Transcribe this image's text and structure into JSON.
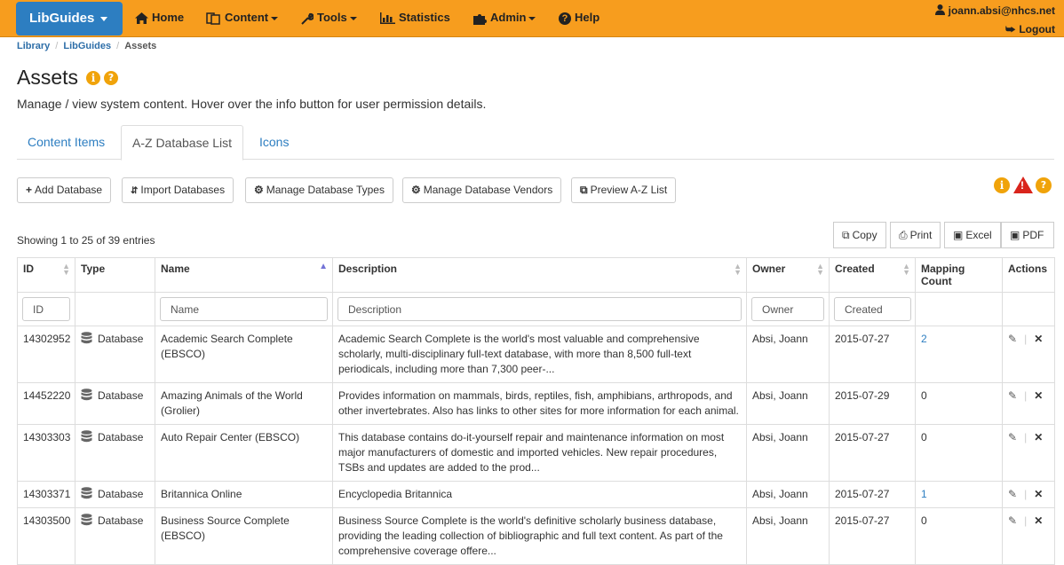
{
  "nav": {
    "brand": "LibGuides",
    "items": [
      {
        "label": "Home",
        "icon": "home-icon"
      },
      {
        "label": "Content",
        "icon": "content-icon"
      },
      {
        "label": "Tools",
        "icon": "wrench-icon"
      },
      {
        "label": "Statistics",
        "icon": "bar-chart-icon"
      },
      {
        "label": "Admin",
        "icon": "puzzle-icon"
      },
      {
        "label": "Help",
        "icon": "help-icon"
      }
    ],
    "user_email": "joann.absi@nhcs.net",
    "logout": "Logout"
  },
  "breadcrumb": [
    "Library",
    "LibGuides",
    "Assets"
  ],
  "page": {
    "title": "Assets",
    "subtitle": "Manage / view system content. Hover over the info button for user permission details."
  },
  "tabs": [
    "Content Items",
    "A-Z Database List",
    "Icons"
  ],
  "toolbar": {
    "add": "Add Database",
    "import": "Import Databases",
    "types": "Manage Database Types",
    "vendors": "Manage Database Vendors",
    "preview": "Preview A-Z List"
  },
  "showing": "Showing 1 to 25 of 39 entries",
  "export": {
    "copy": "Copy",
    "print": "Print",
    "excel": "Excel",
    "pdf": "PDF"
  },
  "columns": [
    "ID",
    "Type",
    "Name",
    "Description",
    "Owner",
    "Created",
    "Mapping Count",
    "Actions"
  ],
  "filters": {
    "id": "ID",
    "name": "Name",
    "description": "Description",
    "owner": "Owner",
    "created": "Created"
  },
  "rows": [
    {
      "id": "14302952",
      "type": "Database",
      "name": "Academic Search Complete (EBSCO)",
      "description": "Academic Search Complete is the world's most valuable and comprehensive scholarly, multi-disciplinary full-text database, with more than 8,500 full-text periodicals, including more than 7,300 peer-...",
      "owner": "Absi, Joann",
      "created": "2015-07-27",
      "mapping": "2",
      "mapping_link": true
    },
    {
      "id": "14452220",
      "type": "Database",
      "name": "Amazing Animals of the World (Grolier)",
      "description": "Provides information on mammals, birds, reptiles, fish, amphibians, arthropods, and other invertebrates. Also has links to other sites for more information for each animal.",
      "owner": "Absi, Joann",
      "created": "2015-07-29",
      "mapping": "0",
      "mapping_link": false
    },
    {
      "id": "14303303",
      "type": "Database",
      "name": "Auto Repair Center (EBSCO)",
      "description": "This database contains do-it-yourself repair and maintenance information on most major manufacturers of domestic and imported vehicles. New repair procedures, TSBs and updates are added to the prod...",
      "owner": "Absi, Joann",
      "created": "2015-07-27",
      "mapping": "0",
      "mapping_link": false
    },
    {
      "id": "14303371",
      "type": "Database",
      "name": "Britannica Online",
      "description": "Encyclopedia Britannica",
      "owner": "Absi, Joann",
      "created": "2015-07-27",
      "mapping": "1",
      "mapping_link": true
    },
    {
      "id": "14303500",
      "type": "Database",
      "name": "Business Source Complete (EBSCO)",
      "description": "Business Source Complete is the world's definitive scholarly business database, providing the leading collection of bibliographic and full text content. As part of the comprehensive coverage offere...",
      "owner": "Absi, Joann",
      "created": "2015-07-27",
      "mapping": "0",
      "mapping_link": false
    }
  ]
}
